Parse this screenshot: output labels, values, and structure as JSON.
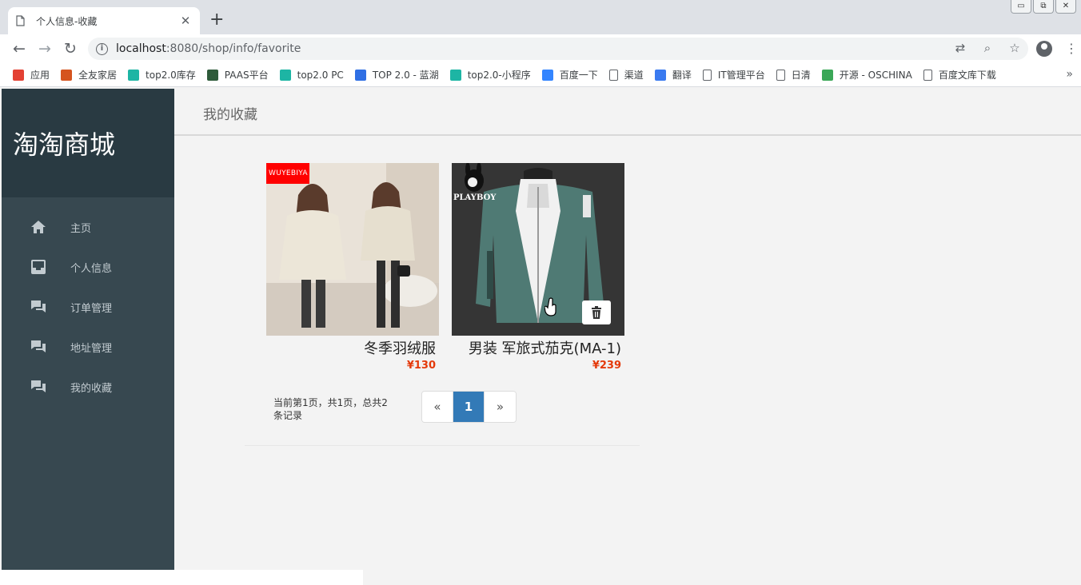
{
  "browser": {
    "tab_title": "个人信息-收藏",
    "new_tab": "+",
    "url_host": "localhost",
    "url_path": ":8080/shop/info/favorite",
    "win_minimize": "▭",
    "win_restore": "⧉",
    "win_close": "✕",
    "bookmarks": [
      {
        "label": "应用",
        "icon": "apps-icon",
        "color": "#e34133"
      },
      {
        "label": "全友家居",
        "icon": "quanyou-icon",
        "color": "#d5541f"
      },
      {
        "label": "top2.0库存",
        "icon": "top-icon",
        "color": "#1db5a4"
      },
      {
        "label": "PAAS平台",
        "icon": "paas-icon",
        "color": "#2e5b3a"
      },
      {
        "label": "top2.0 PC",
        "icon": "top-icon",
        "color": "#1db5a4"
      },
      {
        "label": "TOP 2.0 - 蓝湖",
        "icon": "lanhu-icon",
        "color": "#2f6fe4"
      },
      {
        "label": "top2.0-小程序",
        "icon": "top-icon",
        "color": "#1db5a4"
      },
      {
        "label": "百度一下",
        "icon": "baidu-icon",
        "color": "#3385ff"
      },
      {
        "label": "渠道",
        "icon": "page-icon",
        "color": "#ffffff"
      },
      {
        "label": "翻译",
        "icon": "translate-icon",
        "color": "#3a7af0"
      },
      {
        "label": "IT管理平台",
        "icon": "page-icon",
        "color": "#ffffff"
      },
      {
        "label": "日清",
        "icon": "page-icon",
        "color": "#ffffff"
      },
      {
        "label": "开源 - OSCHINA",
        "icon": "oschina-icon",
        "color": "#3aa757"
      },
      {
        "label": "百度文库下载",
        "icon": "page-icon",
        "color": "#ffffff"
      }
    ],
    "bookmarks_more": "»"
  },
  "sidebar": {
    "brand": "淘淘商城",
    "items": [
      {
        "label": "主页",
        "icon": "home-icon"
      },
      {
        "label": "个人信息",
        "icon": "inbox-icon"
      },
      {
        "label": "订单管理",
        "icon": "chat-icon"
      },
      {
        "label": "地址管理",
        "icon": "chat-icon"
      },
      {
        "label": "我的收藏",
        "icon": "chat-icon"
      }
    ]
  },
  "header": {
    "title": "我的收藏"
  },
  "products": [
    {
      "name": "冬季羽绒服",
      "price": "¥130",
      "badge": "WUYEBIYA"
    },
    {
      "name": "男装 军旅式茄克(MA-1)",
      "price": "¥239",
      "brand_mark": "PLAYBOY"
    }
  ],
  "pagination": {
    "info": "当前第1页，共1页，总共2条记录",
    "prev": "«",
    "current": "1",
    "next": "»"
  },
  "colors": {
    "sidebar_bg": "#374850",
    "brand_bg": "#293a42",
    "price": "#e4390a",
    "pager_active": "#337ab7"
  }
}
